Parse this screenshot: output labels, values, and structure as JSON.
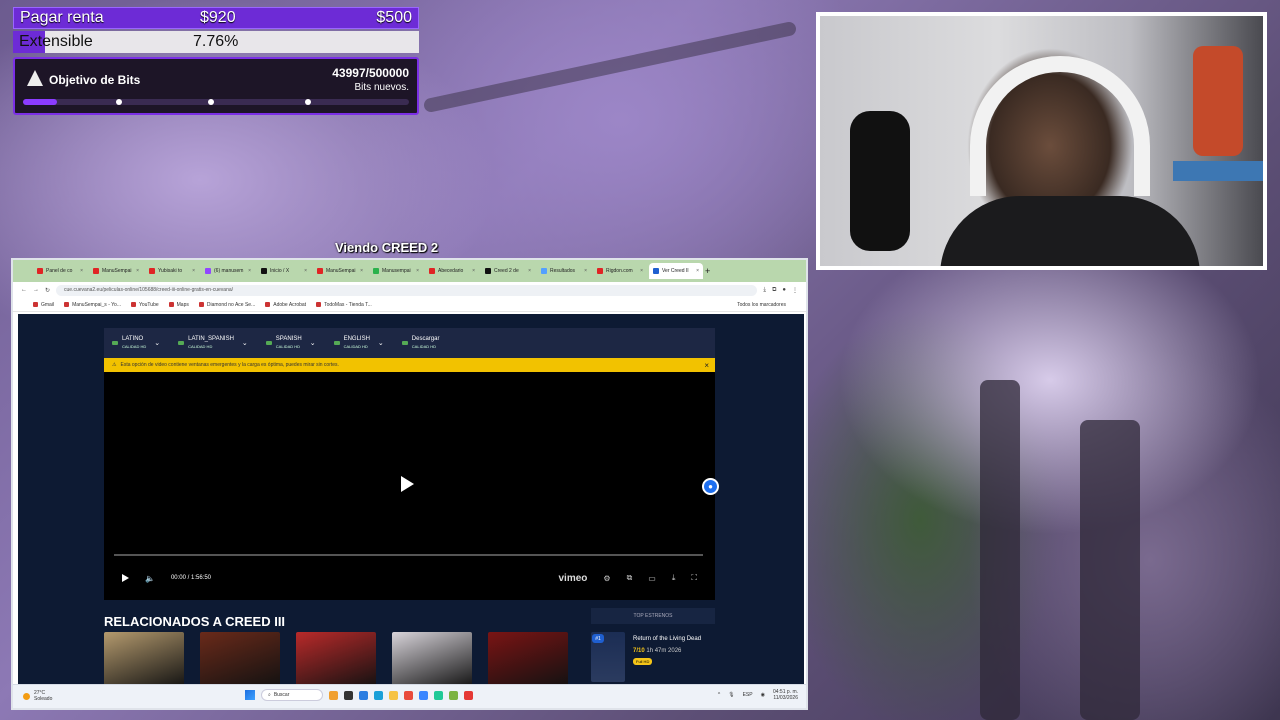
{
  "overlay": {
    "rent": {
      "label": "Pagar renta",
      "value1": "$920",
      "value2": "$500"
    },
    "extensible": {
      "label": "Extensible",
      "percent_text": "7.76%",
      "fill_fraction": 0.0776
    },
    "bits_goal": {
      "title": "Objetivo de Bits",
      "value": "43997/500000",
      "subtitle": "Bits nuevos.",
      "progress_fraction": 0.088
    }
  },
  "watching_label": "Viendo CREED 2",
  "browser": {
    "tabs": [
      {
        "label": "Panel de co",
        "color": "#e02424"
      },
      {
        "label": "ManuSempai",
        "color": "#e02424"
      },
      {
        "label": "Yubisaki to",
        "color": "#e02424"
      },
      {
        "label": "(6) manusem",
        "color": "#9147ff"
      },
      {
        "label": "Inicio / X",
        "color": "#111111"
      },
      {
        "label": "ManuSempai",
        "color": "#e02424"
      },
      {
        "label": "Manusempai",
        "color": "#2bb24c"
      },
      {
        "label": "Abecedario",
        "color": "#e02424"
      },
      {
        "label": "Creed 2 de",
        "color": "#111111"
      },
      {
        "label": "Resultados",
        "color": "#53a0ff"
      },
      {
        "label": "Rigdon.com",
        "color": "#e02424"
      },
      {
        "label": "Ver Creed II",
        "color": "#1f5fd0",
        "active": true
      }
    ],
    "url": "cue.cuevana2.eu/peliculas-online/105688/creed-iii-online-gratis-en-cuevana/",
    "bookmarks": [
      "Gmail",
      "ManuSempai_s - Yo...",
      "YouTube",
      "Maps",
      "Diamond no Ace Se...",
      "Adobe Acrobat",
      "TodoMas - Tienda T..."
    ],
    "all_bookmarks": "Todos los marcadores"
  },
  "player": {
    "languages": [
      {
        "name": "LATINO",
        "quality": "CALIDAD HD"
      },
      {
        "name": "LATIN_SPANISH",
        "quality": "CALIDAD HD"
      },
      {
        "name": "SPANISH",
        "quality": "CALIDAD HD"
      },
      {
        "name": "ENGLISH",
        "quality": "CALIDAD HD"
      },
      {
        "name": "Descargar",
        "quality": "CALIDAD HD"
      }
    ],
    "warning": "Esta opción de video contiene ventanas emergentes y la carga es óptima, puedes mirar sin cortes.",
    "time": "00:00 / 1:56:50",
    "brand": "vimeo"
  },
  "related": {
    "heading": "RELACIONADOS A CREED III",
    "thumb_colors": [
      "#b49a6e",
      "#6a2a1a",
      "#b92a2a",
      "#d8d4da",
      "#7a1414"
    ]
  },
  "top_estrenos": {
    "heading": "TOP ESTRENOS",
    "item": {
      "rank": "#1",
      "title": "Return of the Living Dead",
      "rating": "7/10",
      "duration": "1h 47m",
      "year": "2026",
      "badge": "Full HD"
    }
  },
  "taskbar": {
    "weather_temp": "27°C",
    "weather_desc": "Soleado",
    "search": "Buscar",
    "lang": "ESP",
    "time": "04:51 p. m.",
    "date": "11/03/2026"
  }
}
